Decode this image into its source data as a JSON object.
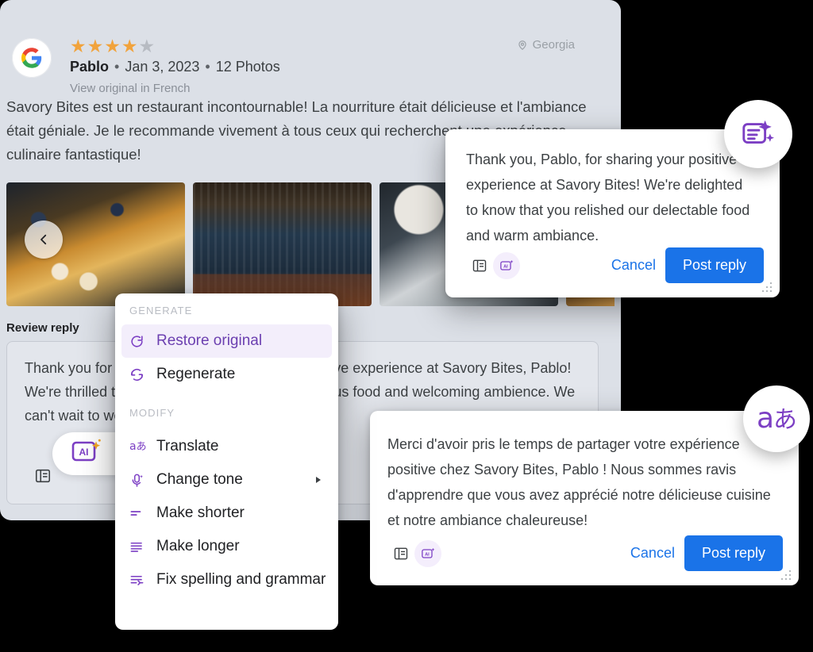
{
  "review": {
    "platform_icon": "google-logo-icon",
    "rating": 4,
    "rating_max": 5,
    "author": "Pablo",
    "date": "Jan 3, 2023",
    "photos_count_label": "12 Photos",
    "separator": "•",
    "view_original_label": "View original in French",
    "location": "Georgia",
    "location_icon": "map-pin-icon",
    "body": "Savory Bites est un restaurant incontournable! La nourriture était délicieuse et l'ambiance était géniale. Je le recommande vivement à tous ceux qui recherchent une expérience culinaire fantastique!",
    "carousel": {
      "prev_icon": "chevron-left-icon",
      "photos": [
        "french-toast-photo",
        "bar-interior-photo",
        "table-setting-photo",
        "dish-photo"
      ]
    }
  },
  "reply_section": {
    "label": "Review reply",
    "text": "Thank you for taking the time to share your positive experience at Savory Bites, Pablo! We're thrilled to hear that you enjoyed our delicious food and welcoming ambience. We can't wait to welcome you back!",
    "format_icon": "text-format-icon",
    "ai_icon": "ai-sparkle-icon"
  },
  "menu": {
    "sections": [
      {
        "title": "GENERATE",
        "items": [
          {
            "label": "Restore original",
            "icon": "restore-icon",
            "active": true,
            "submenu": false
          },
          {
            "label": "Regenerate",
            "icon": "regenerate-icon",
            "active": false,
            "submenu": false
          }
        ]
      },
      {
        "title": "MODIFY",
        "items": [
          {
            "label": "Translate",
            "icon": "translate-icon",
            "active": false,
            "submenu": false
          },
          {
            "label": "Change tone",
            "icon": "change-tone-icon",
            "active": false,
            "submenu": true
          },
          {
            "label": "Make shorter",
            "icon": "make-shorter-icon",
            "active": false,
            "submenu": false
          },
          {
            "label": "Make longer",
            "icon": "make-longer-icon",
            "active": false,
            "submenu": false
          },
          {
            "label": "Fix spelling and grammar",
            "icon": "spellcheck-icon",
            "active": false,
            "submenu": false
          }
        ]
      }
    ]
  },
  "card_english": {
    "text": "Thank you, Pablo, for sharing your positive experience at Savory Bites! We're delighted to know that you relished our delectable food and warm ambiance.",
    "cancel_label": "Cancel",
    "post_label": "Post reply",
    "format_icon": "text-format-icon",
    "ai_icon": "ai-sparkle-icon",
    "resize_icon": "resize-grip-icon"
  },
  "card_french": {
    "text": "Merci d'avoir pris le temps de partager votre expérience positive chez Savory Bites, Pablo ! Nous sommes ravis d'apprendre que vous avez apprécié notre délicieuse cuisine et notre ambiance chaleureuse!",
    "cancel_label": "Cancel",
    "post_label": "Post reply",
    "format_icon": "text-format-icon",
    "ai_icon": "ai-sparkle-icon",
    "resize_icon": "resize-grip-icon"
  },
  "badges": {
    "generate_icon": "ai-generate-text-icon",
    "translate_icon": "translate-a-icon",
    "translate_glyph_latin": "a",
    "translate_glyph_japanese": "あ"
  },
  "colors": {
    "accent_blue": "#1a73e8",
    "accent_purple": "#7c3fc4",
    "star_on": "#f1a33c",
    "star_off": "#b7bbc2",
    "panel_bg": "#dce0e7"
  }
}
